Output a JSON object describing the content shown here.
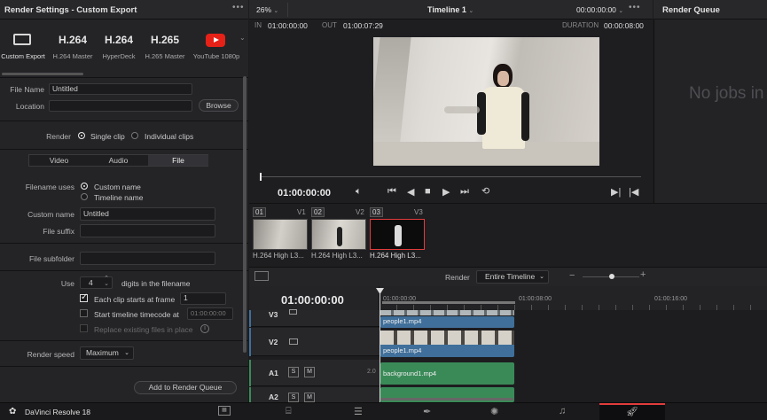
{
  "render_settings": {
    "title": "Render Settings - Custom Export",
    "presets": [
      {
        "name": "Custom Export",
        "heading": ""
      },
      {
        "name": "H.264 Master",
        "heading": "H.264"
      },
      {
        "name": "HyperDeck",
        "heading": "H.264"
      },
      {
        "name": "H.265 Master",
        "heading": "H.265"
      },
      {
        "name": "YouTube 1080p",
        "heading": ""
      }
    ],
    "file_name_label": "File Name",
    "file_name_value": "Untitled",
    "location_label": "Location",
    "location_value": "",
    "browse_label": "Browse",
    "render_label": "Render",
    "single_clip": "Single clip",
    "individual_clips": "Individual clips",
    "tabs": [
      "Video",
      "Audio",
      "File"
    ],
    "active_tab": "File",
    "filename_uses_label": "Filename uses",
    "custom_name_option": "Custom name",
    "timeline_name_option": "Timeline name",
    "custom_name_label": "Custom name",
    "custom_name_value": "Untitled",
    "file_suffix_label": "File suffix",
    "file_suffix_value": "",
    "file_subfolder_label": "File subfolder",
    "file_subfolder_value": "",
    "use_label": "Use",
    "digits_value": "4",
    "digits_label": "digits in the filename",
    "each_clip_label": "Each clip starts at frame",
    "each_clip_value": "1",
    "start_tc_label": "Start timeline timecode at",
    "start_tc_value": "01:00:00:00",
    "replace_label": "Replace existing files in place",
    "render_speed_label": "Render speed",
    "render_speed_value": "Maximum",
    "add_to_queue": "Add to Render Queue"
  },
  "viewer": {
    "zoom": "26%",
    "timeline_name": "Timeline 1",
    "timecode_top": "00:00:00:00",
    "in_label": "IN",
    "in_value": "01:00:00:00",
    "out_label": "OUT",
    "out_value": "01:00:07:29",
    "duration_label": "DURATION",
    "duration_value": "00:00:08:00",
    "current_tc": "01:00:00:00"
  },
  "clips": [
    {
      "num": "01",
      "track": "V1",
      "name": "H.264 High L3..."
    },
    {
      "num": "02",
      "track": "V2",
      "name": "H.264 High L3..."
    },
    {
      "num": "03",
      "track": "V3",
      "name": "H.264 High L3..."
    }
  ],
  "render_queue": {
    "title": "Render Queue",
    "empty_text": "No jobs in"
  },
  "timeline": {
    "render_label": "Render",
    "render_mode": "Entire Timeline",
    "timecode": "01:00:00:00",
    "ruler": [
      "01:00:00:00",
      "01:00:08:00",
      "01:00:16:00"
    ],
    "tracks": [
      {
        "id": "V3",
        "clip": ""
      },
      {
        "id": "V2",
        "clip": "people1.mp4"
      },
      {
        "id": "V1",
        "clip": "people1.mp4"
      },
      {
        "id": "A1",
        "clip": "background1.mp4",
        "level": "2.0"
      },
      {
        "id": "A2",
        "clip": ""
      }
    ],
    "track_buttons": [
      "S",
      "M"
    ]
  },
  "dock": {
    "app_name": "DaVinci Resolve 18"
  },
  "colors": {
    "accent_red": "#e23c3c",
    "video_clip": "#3f6f9a",
    "audio_clip": "#3a8a58",
    "active_page": "#e23c3c"
  }
}
